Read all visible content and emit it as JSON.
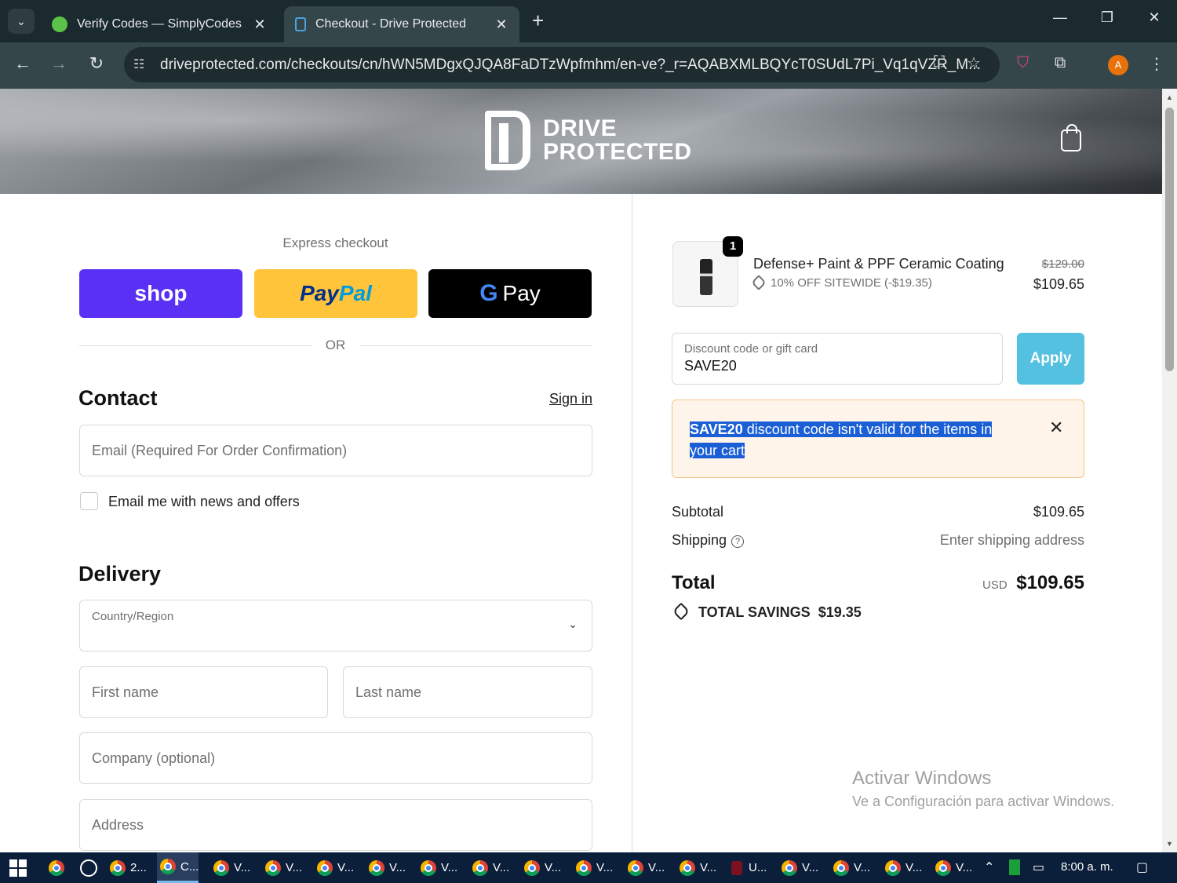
{
  "browser": {
    "tabs": [
      {
        "title": "Verify Codes — SimplyCodes",
        "close": "✕"
      },
      {
        "title": "Checkout - Drive Protected",
        "close": "✕"
      }
    ],
    "new_tab": "+",
    "url": "driveprotected.com/checkouts/cn/hWN5MDgxQJQA8FaDTzWpfmhm/en-ve?_r=AQABXMLBQYcT0SUdL7Pi_Vq1qVZR_M...",
    "profile_initial": "A"
  },
  "site": {
    "logo_line1": "DRIVE",
    "logo_line2": "PROTECTED"
  },
  "checkout": {
    "express_label": "Express checkout",
    "shop_label": "shop",
    "paypal_pay": "Pay",
    "paypal_pal": "Pal",
    "gpay_g": "G",
    "gpay_label": "Pay",
    "or_label": "OR",
    "contact_heading": "Contact",
    "sign_in": "Sign in",
    "email_placeholder": "Email (Required For Order Confirmation)",
    "newsletter_label": "Email me with news and offers",
    "delivery_heading": "Delivery",
    "country_label": "Country/Region",
    "first_name_placeholder": "First name",
    "last_name_placeholder": "Last name",
    "company_placeholder": "Company (optional)",
    "address_placeholder": "Address"
  },
  "order": {
    "item": {
      "quantity": "1",
      "name": "Defense+ Paint & PPF Ceramic Coating",
      "discount": "10% OFF SITEWIDE (-$19.35)",
      "original_price": "$129.00",
      "price": "$109.65"
    },
    "discount_label": "Discount code or gift card",
    "discount_value": "SAVE20",
    "apply_label": "Apply",
    "alert_code": "SAVE20",
    "alert_message": " discount code isn't valid for the items in your cart",
    "subtotal_label": "Subtotal",
    "subtotal_value": "$109.65",
    "shipping_label": "Shipping",
    "shipping_value": "Enter shipping address",
    "total_label": "Total",
    "total_currency": "USD",
    "total_value": "$109.65",
    "savings_label": "TOTAL SAVINGS",
    "savings_value": "$19.35"
  },
  "watermark": {
    "line1": "Activar Windows",
    "line2": "Ve a Configuración para activar Windows."
  },
  "taskbar": {
    "items": [
      "2...",
      "C...",
      "V...",
      "V...",
      "V...",
      "V...",
      "V...",
      "V...",
      "V...",
      "V...",
      "V...",
      "V...",
      "U...",
      "V...",
      "V...",
      "V...",
      "V..."
    ],
    "time": "8:00 a. m."
  }
}
